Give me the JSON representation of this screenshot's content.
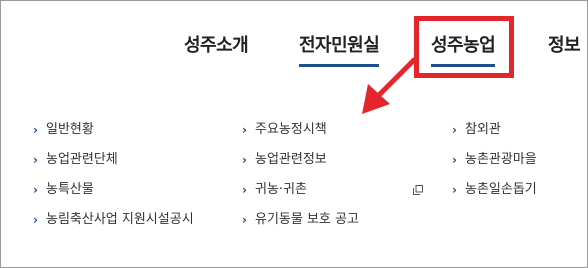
{
  "nav": {
    "items": [
      {
        "label": "성주소개"
      },
      {
        "label": "전자민원실"
      },
      {
        "label": "성주농업"
      },
      {
        "label": "정보"
      }
    ]
  },
  "submenu": {
    "columns": [
      {
        "items": [
          {
            "label": "일반현황"
          },
          {
            "label": "농업관련단체"
          },
          {
            "label": "농특산물"
          },
          {
            "label": "농림축산사업 지원시설공시"
          }
        ]
      },
      {
        "items": [
          {
            "label": "주요농정시책"
          },
          {
            "label": "농업관련정보"
          },
          {
            "label": "귀농·귀촌"
          },
          {
            "label": "유기동물 보호 공고"
          }
        ]
      },
      {
        "items": [
          {
            "label": "참외관"
          },
          {
            "label": "농촌관광마을"
          },
          {
            "label": "농촌일손돕기"
          }
        ]
      }
    ],
    "external_link_icon": "new-window-icon"
  },
  "colors": {
    "accent": "#1f4e8c",
    "highlight": "#e3262b",
    "text": "#333333"
  }
}
